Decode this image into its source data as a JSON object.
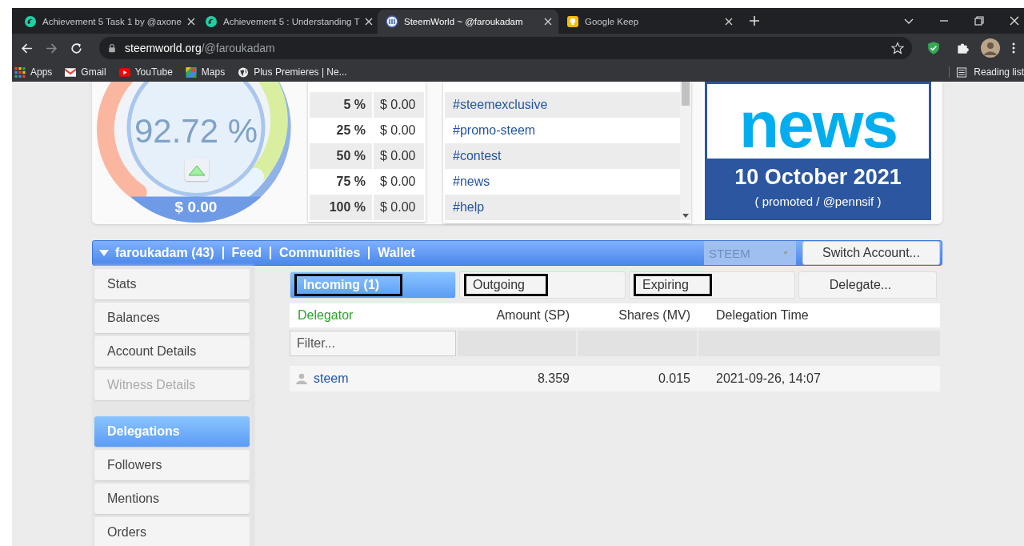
{
  "browser": {
    "tabs": [
      {
        "title": "Achievement 5 Task 1 by @axone",
        "selected": false
      },
      {
        "title": "Achievement 5 : Understanding T",
        "selected": false
      },
      {
        "title": "SteemWorld ~ @faroukadam",
        "selected": true
      },
      {
        "title": "Google Keep",
        "selected": false
      }
    ],
    "address": {
      "host": "steemworld.org",
      "path": "/@faroukadam"
    },
    "bookmarks": [
      "Apps",
      "Gmail",
      "YouTube",
      "Maps",
      "Plus Premieres | Ne..."
    ],
    "reading_list": "Reading list"
  },
  "gauge": {
    "percent": "92.72 %",
    "value": "$ 0.00"
  },
  "vote_table": [
    {
      "pct": "5 %",
      "value": "$ 0.00"
    },
    {
      "pct": "25 %",
      "value": "$ 0.00"
    },
    {
      "pct": "50 %",
      "value": "$ 0.00"
    },
    {
      "pct": "75 %",
      "value": "$ 0.00"
    },
    {
      "pct": "100 %",
      "value": "$ 0.00"
    }
  ],
  "tags": [
    "#steemexclusive",
    "#promo-steem",
    "#contest",
    "#news",
    "#help"
  ],
  "news": {
    "word": "news",
    "date": "10 October 2021",
    "note": "( promoted / @pennsif )"
  },
  "account_bar": {
    "links": [
      "faroukadam (43)",
      "Feed",
      "Communities",
      "Wallet"
    ],
    "select": {
      "value": "STEEM",
      "disabled": true
    },
    "button": "Switch Account..."
  },
  "sidebar": {
    "groups": [
      [
        {
          "label": "Stats",
          "selected": false,
          "disabled": false
        },
        {
          "label": "Balances",
          "selected": false,
          "disabled": false
        },
        {
          "label": "Account Details",
          "selected": false,
          "disabled": false
        },
        {
          "label": "Witness Details",
          "selected": false,
          "disabled": true
        }
      ],
      [
        {
          "label": "Delegations",
          "selected": true,
          "disabled": false
        },
        {
          "label": "Followers",
          "selected": false,
          "disabled": false
        },
        {
          "label": "Mentions",
          "selected": false,
          "disabled": false
        },
        {
          "label": "Orders",
          "selected": false,
          "disabled": false
        }
      ]
    ]
  },
  "delegation_tabs": [
    {
      "label": "Incoming (1)",
      "selected": true,
      "marked": true
    },
    {
      "label": "Outgoing",
      "selected": false,
      "marked": true
    },
    {
      "label": "Expiring",
      "selected": false,
      "marked": true
    },
    {
      "label": "Delegate...",
      "selected": false,
      "marked": false
    }
  ],
  "table": {
    "columns": [
      "Delegator",
      "Amount (SP)",
      "Shares (MV)",
      "Delegation Time"
    ],
    "filter": {
      "placeholder": "Filter..."
    },
    "rows": [
      [
        "steem",
        "8.359",
        "0.015",
        "2021-09-26, 14:07"
      ]
    ]
  }
}
